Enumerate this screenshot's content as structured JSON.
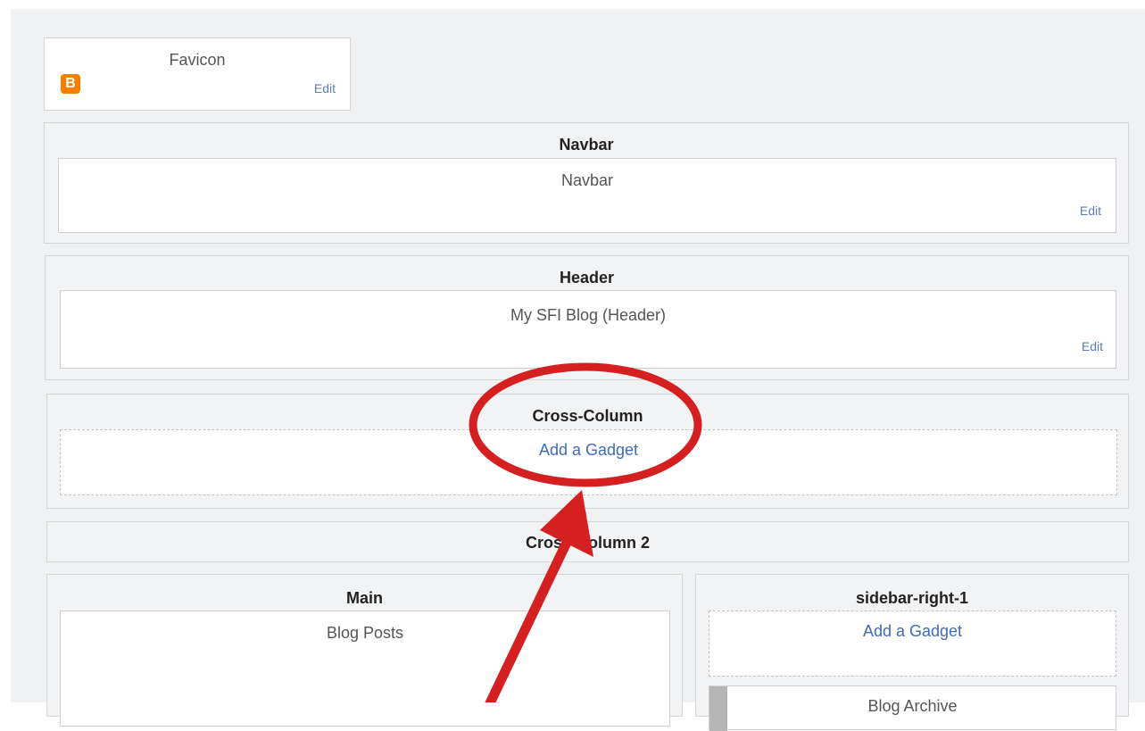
{
  "favicon": {
    "title": "Favicon",
    "edit_label": "Edit",
    "logo_letter": "B"
  },
  "navbar": {
    "title": "Navbar",
    "gadget_name": "Navbar",
    "edit_label": "Edit"
  },
  "header": {
    "title": "Header",
    "gadget_name": "My SFI Blog (Header)",
    "edit_label": "Edit"
  },
  "cross_column": {
    "title": "Cross-Column",
    "add_gadget_label": "Add a Gadget"
  },
  "cross_column_2": {
    "title": "Cross-Column 2"
  },
  "main": {
    "title": "Main",
    "gadget_name": "Blog Posts"
  },
  "sidebar_right_1": {
    "title": "sidebar-right-1",
    "add_gadget_label": "Add a Gadget",
    "partial_gadget_name": "Blog Archive"
  },
  "annotation": {
    "color": "#d42020"
  }
}
